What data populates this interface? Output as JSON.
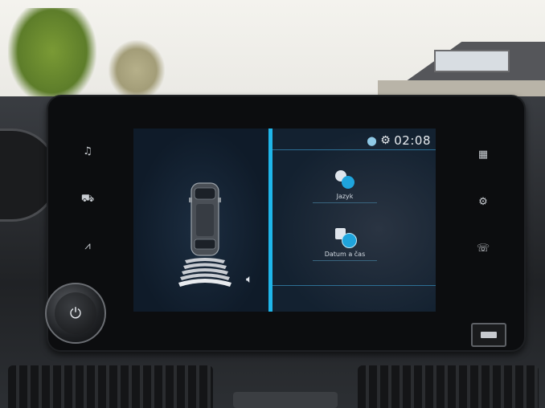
{
  "status_bar": {
    "time": "02:08",
    "location_icon": "location-pin-icon",
    "settings_icon": "gear-icon"
  },
  "settings_menu": {
    "items": [
      {
        "label": "Jazyk",
        "icon": "language-chat-icon"
      },
      {
        "label": "Datum a čas",
        "icon": "date-time-icon"
      }
    ]
  },
  "parking_view": {
    "sensor_icon": "speaker-icon",
    "rear_proximity_bars": 5
  },
  "left_buttons": [
    {
      "icon": "music-note-icon",
      "glyph": "♫"
    },
    {
      "icon": "car-icon",
      "glyph": "⛟"
    },
    {
      "icon": "navigation-icon",
      "glyph": "⩘"
    }
  ],
  "right_buttons": [
    {
      "icon": "apps-grid-icon",
      "glyph": "▦"
    },
    {
      "icon": "settings-gear-icon",
      "glyph": "⚙"
    },
    {
      "icon": "phone-icon",
      "glyph": "☏"
    }
  ],
  "colors": {
    "accent": "#1fb6ea",
    "screen_bg": "#0d1a28"
  }
}
